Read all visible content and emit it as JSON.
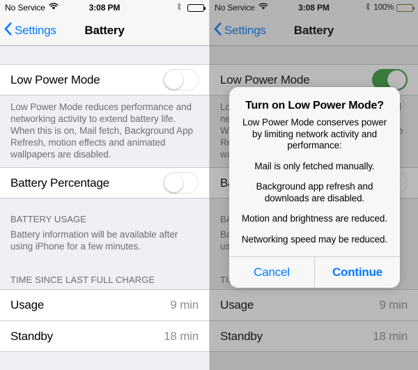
{
  "panels": {
    "left": {
      "status_bar": {
        "carrier": "No Service",
        "time": "3:08 PM",
        "battery_percent": "",
        "wifi_icon": "wifi-icon",
        "bluetooth_icon": "bluetooth-icon",
        "battery_icon": "battery-full-icon"
      },
      "nav": {
        "back_label": "Settings",
        "title": "Battery",
        "back_icon": "chevron-left-icon"
      },
      "low_power_mode": {
        "label": "Low Power Mode",
        "state": "off",
        "footnote": "Low Power Mode reduces performance and networking activity to extend battery life.  When this is on, Mail fetch, Background App Refresh, motion effects and animated wallpapers are disabled."
      },
      "battery_percentage": {
        "label": "Battery Percentage",
        "state": "off"
      },
      "battery_usage": {
        "header": "BATTERY USAGE",
        "note": "Battery information will be available after using iPhone for a few minutes."
      },
      "time_since_charge": {
        "header": "TIME SINCE LAST FULL CHARGE",
        "rows": [
          {
            "label": "Usage",
            "value": "9 min"
          },
          {
            "label": "Standby",
            "value": "18 min"
          }
        ]
      }
    },
    "right": {
      "status_bar": {
        "carrier": "No Service",
        "time": "3:08 PM",
        "battery_percent": "100%",
        "wifi_icon": "wifi-icon",
        "bluetooth_icon": "bluetooth-icon",
        "battery_icon": "battery-low-power-icon"
      },
      "nav": {
        "back_label": "Settings",
        "title": "Battery",
        "back_icon": "chevron-left-icon"
      },
      "low_power_mode": {
        "label": "Low Power Mode",
        "state": "on",
        "footnote": "Low Power Mode reduces performance and networking activity to extend battery life.  When this is on, Mail fetch, Background App Refresh, motion effects and animated wallpapers are disabled."
      },
      "battery_percentage": {
        "label": "Battery Percentage",
        "state": "off"
      },
      "battery_usage": {
        "header": "BATTERY USAGE",
        "note": "Battery information will be available after using iPhone for a few minutes."
      },
      "time_since_charge": {
        "header": "TIME SINCE LAST FULL CHARGE",
        "rows": [
          {
            "label": "Usage",
            "value": "9 min"
          },
          {
            "label": "Standby",
            "value": "18 min"
          }
        ]
      },
      "alert": {
        "title": "Turn on Low Power Mode?",
        "message": "Low Power Mode conserves power by limiting network activity and performance:",
        "bullets": [
          "Mail is only fetched manually.",
          "Background app refresh and downloads are disabled.",
          "Motion and brightness are reduced.",
          "Networking speed may be reduced."
        ],
        "cancel_label": "Cancel",
        "continue_label": "Continue"
      }
    }
  },
  "colors": {
    "accent_blue": "#007aff",
    "toggle_on_green": "#3a9d3d",
    "battery_yellow": "#e8c33c",
    "group_background": "#efeff4",
    "secondary_text": "#6d6d72"
  }
}
